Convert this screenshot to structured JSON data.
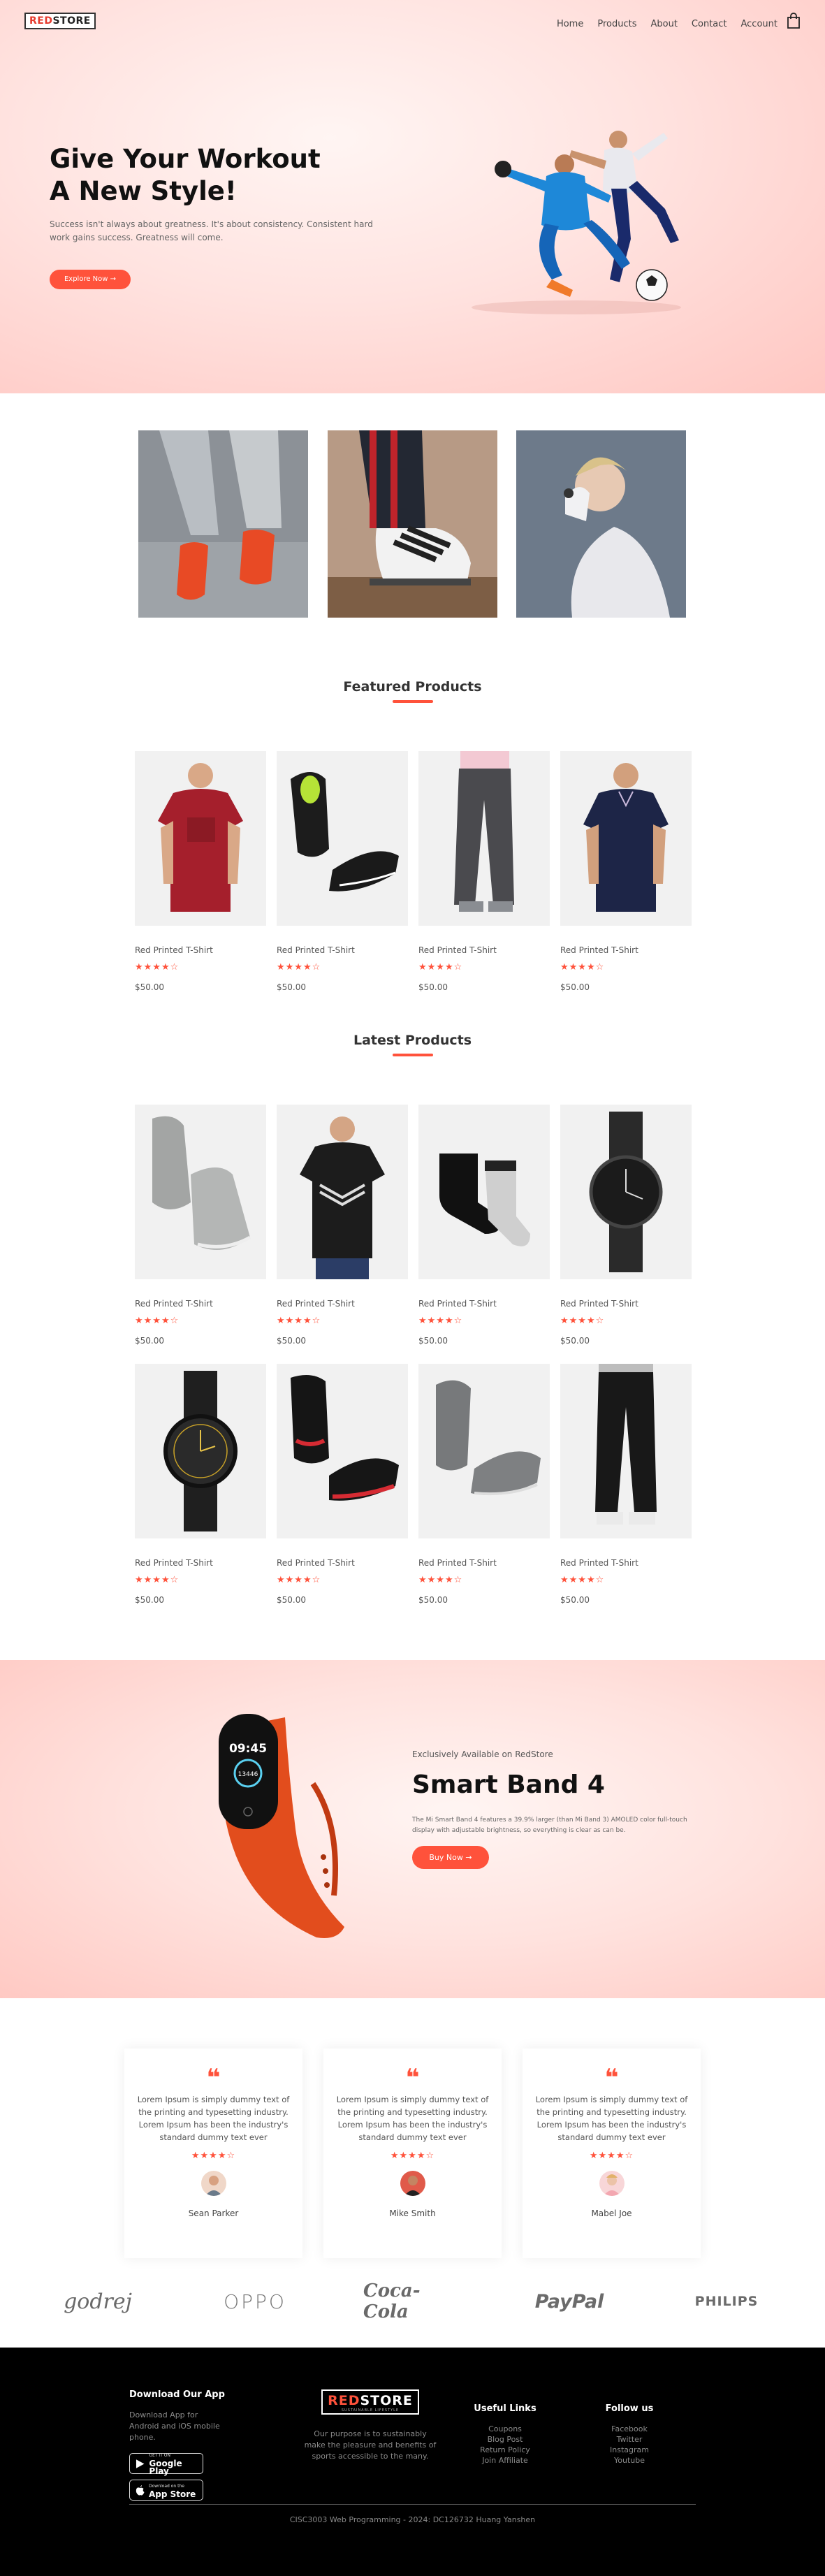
{
  "header": {
    "logo_red": "RED",
    "logo_dark": "STORE",
    "menu": [
      "Home",
      "Products",
      "About",
      "Contact",
      "Account"
    ]
  },
  "hero": {
    "title_line1": "Give Your Workout",
    "title_line2": "A New Style!",
    "subtitle": "Success isn't always about greatness. It's about consistency. Consistent hard work gains success. Greatness will come.",
    "cta": "Explore Now →"
  },
  "featured": {
    "title": "Featured Products",
    "products": [
      {
        "name": "Red Printed T-Shirt",
        "price": "$50.00",
        "rating": 4
      },
      {
        "name": "Red Printed T-Shirt",
        "price": "$50.00",
        "rating": 4
      },
      {
        "name": "Red Printed T-Shirt",
        "price": "$50.00",
        "rating": 4
      },
      {
        "name": "Red Printed T-Shirt",
        "price": "$50.00",
        "rating": 4
      }
    ]
  },
  "latest": {
    "title": "Latest Products",
    "products": [
      {
        "name": "Red Printed T-Shirt",
        "price": "$50.00",
        "rating": 4
      },
      {
        "name": "Red Printed T-Shirt",
        "price": "$50.00",
        "rating": 4
      },
      {
        "name": "Red Printed T-Shirt",
        "price": "$50.00",
        "rating": 4
      },
      {
        "name": "Red Printed T-Shirt",
        "price": "$50.00",
        "rating": 4
      },
      {
        "name": "Red Printed T-Shirt",
        "price": "$50.00",
        "rating": 4
      },
      {
        "name": "Red Printed T-Shirt",
        "price": "$50.00",
        "rating": 4
      },
      {
        "name": "Red Printed T-Shirt",
        "price": "$50.00",
        "rating": 4
      },
      {
        "name": "Red Printed T-Shirt",
        "price": "$50.00",
        "rating": 4
      }
    ]
  },
  "stars_text": "★★★★☆",
  "offer": {
    "exclusive": "Exclusively Available on RedStore",
    "title": "Smart Band 4",
    "description": "The Mi Smart Band 4 features a 39.9% larger (than Mi Band 3) AMOLED color full-touch display with adjustable brightness, so everything is clear as can be.",
    "cta": "Buy Now →",
    "band_time": "09:45",
    "band_steps": "13446"
  },
  "testimonials": [
    {
      "text": "Lorem Ipsum is simply dummy text of the printing and typesetting industry. Lorem Ipsum has been the industry's standard dummy text ever",
      "name": "Sean Parker",
      "rating": 4
    },
    {
      "text": "Lorem Ipsum is simply dummy text of the printing and typesetting industry. Lorem Ipsum has been the industry's standard dummy text ever",
      "name": "Mike Smith",
      "rating": 4
    },
    {
      "text": "Lorem Ipsum is simply dummy text of the printing and typesetting industry. Lorem Ipsum has been the industry's standard dummy text ever",
      "name": "Mabel Joe",
      "rating": 4
    }
  ],
  "brands": [
    "godrej",
    "OPPO",
    "Coca-Cola",
    "PayPal",
    "PHILIPS"
  ],
  "footer": {
    "download_title": "Download Our App",
    "download_text": "Download App for Android and iOS mobile phone.",
    "google_small": "GET IT ON",
    "google_big": "Google Play",
    "apple_small": "Download on the",
    "apple_big": "App Store",
    "logo_red": "RED",
    "logo_white": "STORE",
    "logo_tag": "SUSTAINABLE LIFESTYLE",
    "purpose": "Our purpose is to sustainably make the pleasure and benefits of sports accessible to the many.",
    "useful_title": "Useful Links",
    "useful_links": [
      "Coupons",
      "Blog Post",
      "Return Policy",
      "Join Affiliate"
    ],
    "follow_title": "Follow us",
    "follow_links": [
      "Facebook",
      "Twitter",
      "Instagram",
      "Youtube"
    ],
    "copyright": "CISC3003 Web Programming - 2024: DC126732 Huang Yanshen"
  }
}
